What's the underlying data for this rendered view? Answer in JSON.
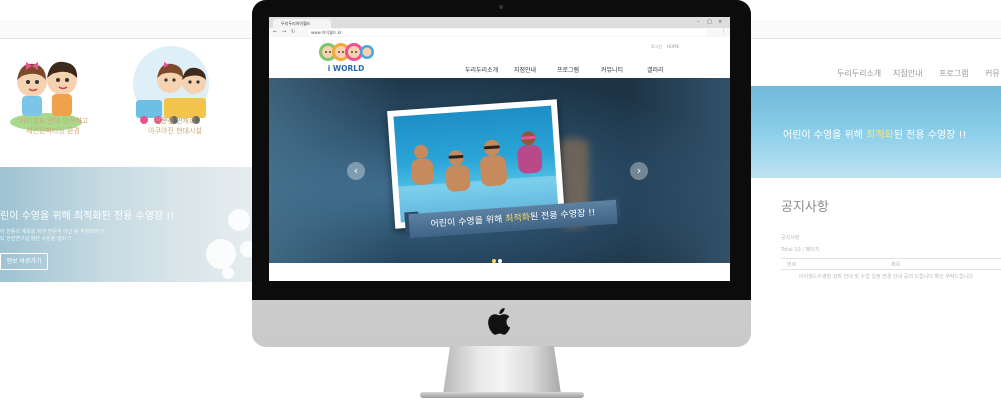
{
  "left_panel": {
    "feature1_text": [
      "'아이월드'관이 안전하고",
      "세련된파티상 환경"
    ],
    "feature2_text": [
      "전문성 인재로",
      "아쿠아진 현대시설"
    ],
    "banner_title": "린이 수영을 위해 최적화된 전용 수영장 !!",
    "banner_desc": [
      "아 전용의 체육을 위한 전문적 아닌 를 추정되어 !!",
      "되 안전연구실 향된 수운을 않이 !!"
    ],
    "banner_button": "앤보 바로가기"
  },
  "right_panel": {
    "nav": [
      "두리두리소개",
      "지점안내",
      "프로그램",
      "커뮤"
    ],
    "banner_title_before": "어린이 수영을 위해 ",
    "banner_title_highlight": "최적화",
    "banner_title_after": "된 전용 수영장 !!",
    "notice_title": "공지사항",
    "notice_sub": "공지사항",
    "notice_count": "Total 10 / 페이지",
    "table_headers": [
      "번호",
      "제목"
    ],
    "table_row": "아이월드수영장 강좌 안내 및 수업 일정 변경 안내 공지 드립니다 확인 부탁드립니다"
  },
  "browser": {
    "tab_title": "두리두리아이월드",
    "address": "www.아이월드.kr",
    "util_links": [
      "로그인",
      "HOME"
    ]
  },
  "site": {
    "logo_text": "i WORLD",
    "menu": [
      "두리두리소개",
      "지점안내",
      "프로그램",
      "커뮤니티",
      "갤러리"
    ],
    "hero_caption_before": "어린이 수영을 위해 ",
    "hero_caption_highlight": "최적화",
    "hero_caption_after": "된 전용 수영장 !!",
    "slider_prev": "‹",
    "slider_next": "›",
    "slide_count": 2,
    "active_slide": 1
  },
  "colors": {
    "accent_yellow": "#ffd95c",
    "ribbon_blue": "#4a6e8f",
    "pool_blue": "#2aa5d8"
  },
  "icons": [
    "apple-logo-icon",
    "back-arrow-icon",
    "forward-arrow-icon",
    "reload-icon",
    "menu-icon"
  ]
}
